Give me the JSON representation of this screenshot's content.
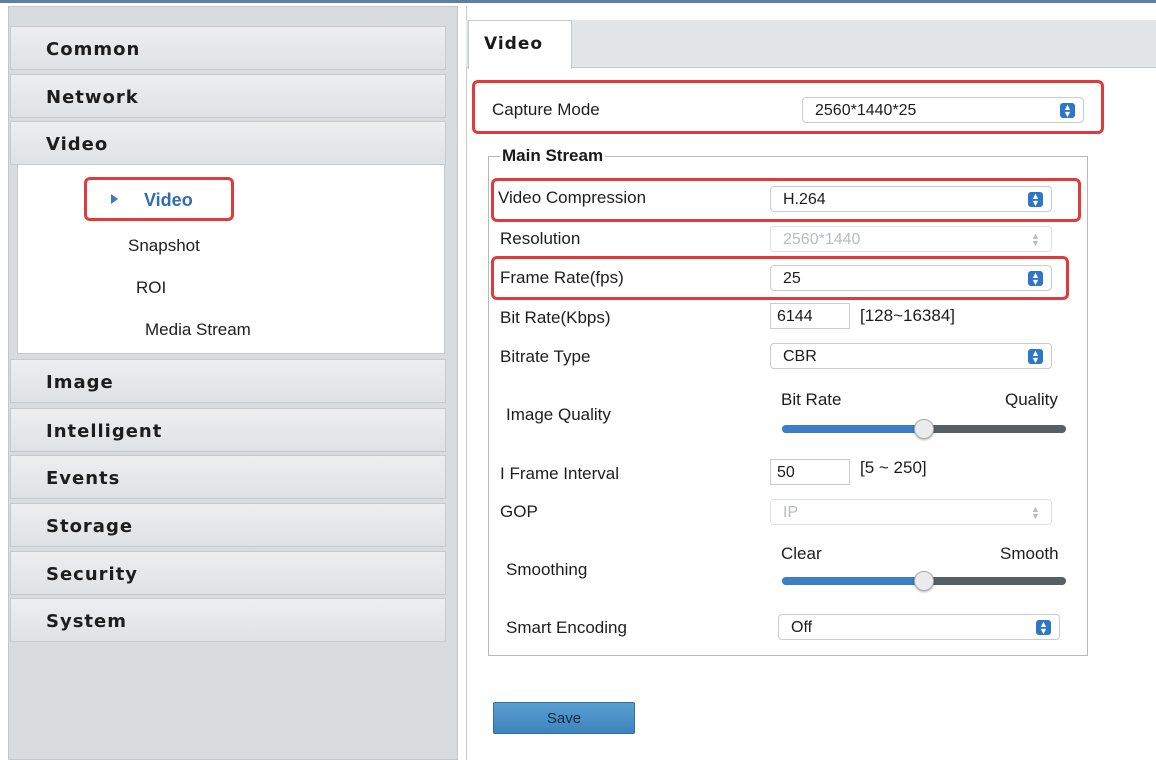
{
  "menu": {
    "common": "Common",
    "network": "Network",
    "video": "Video",
    "video_sub": [
      "Video",
      "Snapshot",
      "ROI",
      "Media Stream"
    ],
    "image": "Image",
    "intelligent": "Intelligent",
    "events": "Events",
    "storage": "Storage",
    "security": "Security",
    "system": "System"
  },
  "tab": "Video",
  "form": {
    "capture_mode": {
      "label": "Capture Mode",
      "value": "2560*1440*25"
    },
    "main_stream": "Main Stream",
    "video_compression": {
      "label": "Video Compression",
      "value": "H.264"
    },
    "resolution": {
      "label": "Resolution",
      "value": "2560*1440"
    },
    "frame_rate": {
      "label": "Frame Rate(fps)",
      "value": "25"
    },
    "bit_rate": {
      "label": "Bit Rate(Kbps)",
      "value": "6144",
      "range": "[128~16384]"
    },
    "bitrate_type": {
      "label": "Bitrate Type",
      "value": "CBR"
    },
    "image_quality": {
      "label": "Image Quality",
      "left": "Bit Rate",
      "right": "Quality",
      "level": 0.5
    },
    "i_frame_interval": {
      "label": "I Frame Interval",
      "value": "50",
      "range": "[5 ~ 250]"
    },
    "gop": {
      "label": "GOP",
      "value": "IP"
    },
    "smoothing": {
      "label": "Smoothing",
      "left": "Clear",
      "right": "Smooth",
      "level": 0.5
    },
    "smart_encoding": {
      "label": "Smart Encoding",
      "value": "Off"
    },
    "save": "Save"
  },
  "colors": {
    "highlight": "#e03a3a",
    "accent": "#2f76c9"
  }
}
